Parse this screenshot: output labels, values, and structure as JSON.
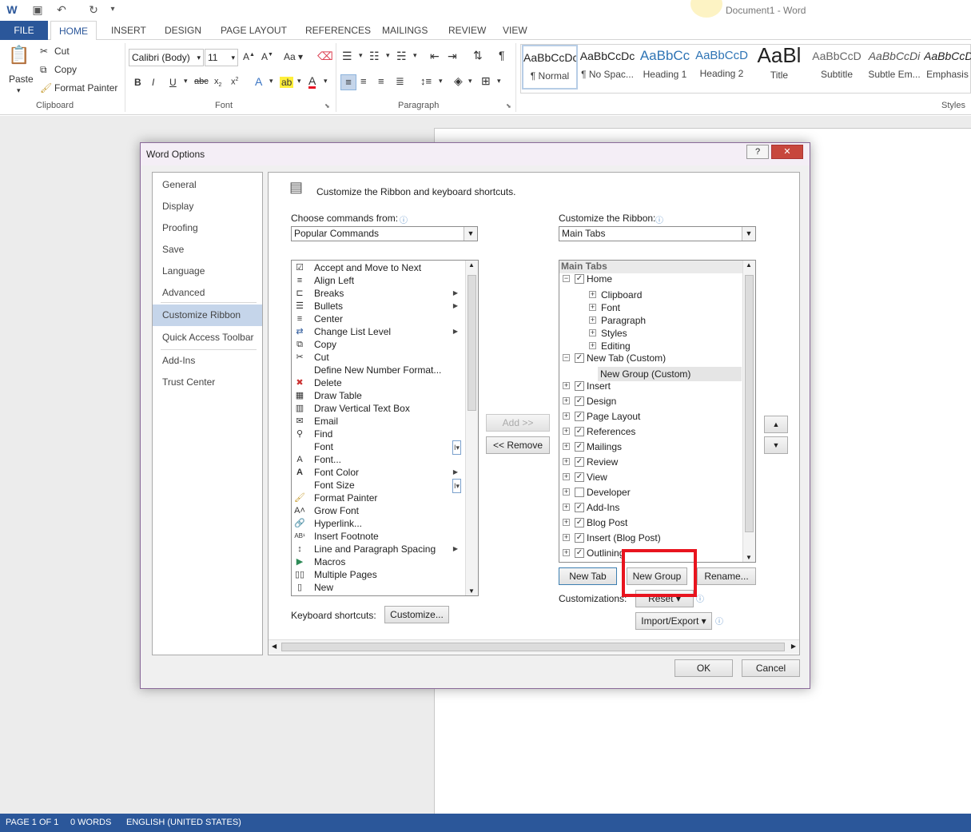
{
  "titlebar": {
    "doc_title": "Document1 - Word",
    "icons": [
      "word-logo-icon",
      "save-icon",
      "undo-icon",
      "redo-icon",
      "customize-qat-icon"
    ]
  },
  "tabs": [
    "FILE",
    "HOME",
    "INSERT",
    "DESIGN",
    "PAGE LAYOUT",
    "REFERENCES",
    "MAILINGS",
    "REVIEW",
    "VIEW"
  ],
  "ribbon": {
    "clipboard": {
      "paste": "Paste",
      "cut": "Cut",
      "copy": "Copy",
      "format_painter": "Format Painter",
      "label": "Clipboard"
    },
    "font": {
      "family": "Calibri (Body)",
      "size": "11",
      "label": "Font"
    },
    "paragraph": {
      "label": "Paragraph"
    },
    "styles": {
      "label": "Styles",
      "tiles": [
        {
          "preview": "AaBbCcDc",
          "name": "¶ Normal"
        },
        {
          "preview": "AaBbCcDc",
          "name": "¶ No Spac..."
        },
        {
          "preview": "AaBbCc",
          "name": "Heading 1"
        },
        {
          "preview": "AaBbCcD",
          "name": "Heading 2"
        },
        {
          "preview": "AaBl",
          "name": "Title"
        },
        {
          "preview": "AaBbCcD",
          "name": "Subtitle"
        },
        {
          "preview": "AaBbCcDi",
          "name": "Subtle Em..."
        },
        {
          "preview": "AaBbCcDi",
          "name": "Emphasis"
        }
      ]
    }
  },
  "dialog": {
    "title": "Word Options",
    "help": "?",
    "close": "✕",
    "nav": [
      "General",
      "Display",
      "Proofing",
      "Save",
      "Language",
      "Advanced",
      "Customize Ribbon",
      "Quick Access Toolbar",
      "Add-Ins",
      "Trust Center"
    ],
    "header": "Customize the Ribbon and keyboard shortcuts.",
    "choose_label": "Choose commands from:",
    "choose_value": "Popular Commands",
    "customize_label": "Customize the Ribbon:",
    "customize_value": "Main Tabs",
    "commands": [
      "Accept and Move to Next",
      "Align Left",
      "Breaks",
      "Bullets",
      "Center",
      "Change List Level",
      "Copy",
      "Cut",
      "Define New Number Format...",
      "Delete",
      "Draw Table",
      "Draw Vertical Text Box",
      "Email",
      "Find",
      "Font",
      "Font...",
      "Font Color",
      "Font Size",
      "Format Painter",
      "Grow Font",
      "Hyperlink...",
      "Insert Footnote",
      "Line and Paragraph Spacing",
      "Macros",
      "Multiple Pages",
      "New"
    ],
    "tree_header": "Main Tabs",
    "tree": {
      "home": "Home",
      "home_groups": [
        "Clipboard",
        "Font",
        "Paragraph",
        "Styles",
        "Editing"
      ],
      "new_tab": "New Tab (Custom)",
      "new_group": "New Group (Custom)",
      "tabs": [
        "Insert",
        "Design",
        "Page Layout",
        "References",
        "Mailings",
        "Review",
        "View",
        "Developer",
        "Add-Ins",
        "Blog Post",
        "Insert (Blog Post)",
        "Outlining"
      ]
    },
    "add_btn": "Add >>",
    "remove_btn": "<< Remove",
    "new_tab_btn": "New Tab",
    "new_group_btn": "New Group",
    "rename_btn": "Rename...",
    "customizations_label": "Customizations:",
    "reset_btn": "Reset ▾",
    "import_export_btn": "Import/Export ▾",
    "keyboard_label": "Keyboard shortcuts:",
    "customize_btn": "Customize...",
    "ok": "OK",
    "cancel": "Cancel"
  },
  "status": {
    "page": "PAGE 1 OF 1",
    "words": "0 WORDS",
    "language": "ENGLISH (UNITED STATES)"
  },
  "colors": {
    "accent": "#2b579a",
    "highlight": "#e8141e",
    "nav_selected": "#c5d5ea"
  }
}
